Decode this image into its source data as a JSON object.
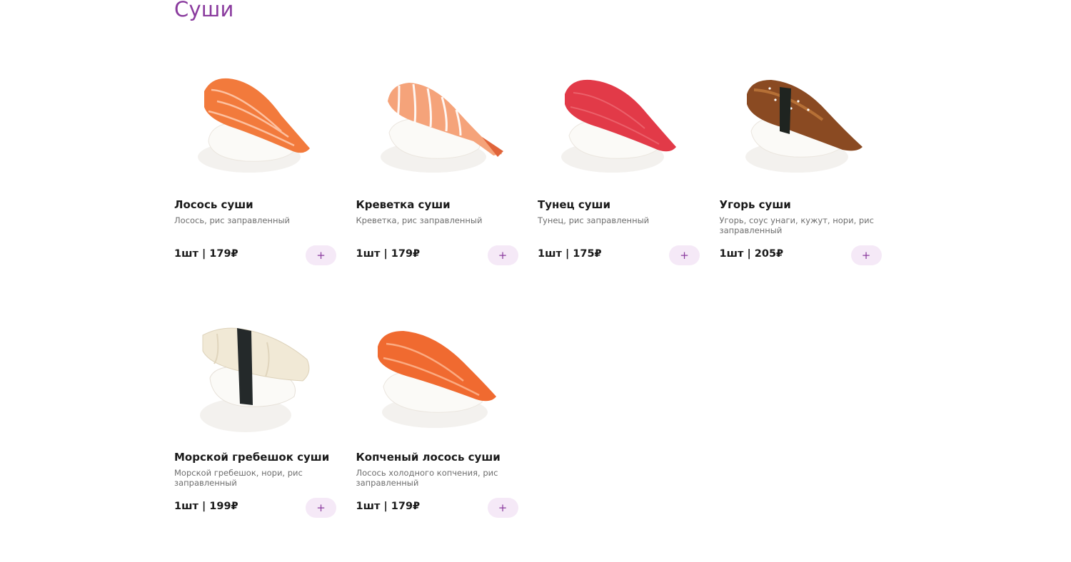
{
  "section": {
    "title": "Суши"
  },
  "products": [
    {
      "name": "Лосось суши",
      "description": "Лосось, рис заправленный",
      "price": "1шт | 179₽",
      "add_label": "+",
      "topping": "salmon",
      "topping_color": "#f27a3c"
    },
    {
      "name": "Креветка суши",
      "description": "Креветка, рис заправленный",
      "price": "1шт | 179₽",
      "add_label": "+",
      "topping": "shrimp",
      "topping_color": "#f5a37a"
    },
    {
      "name": "Тунец суши",
      "description": "Тунец, рис заправленный",
      "price": "1шт | 175₽",
      "add_label": "+",
      "topping": "tuna",
      "topping_color": "#e23a48"
    },
    {
      "name": "Угорь суши",
      "description": "Угорь, соус унаги, кужут, нори, рис заправленный",
      "price": "1шт | 205₽",
      "add_label": "+",
      "topping": "eel",
      "topping_color": "#8a4a22"
    },
    {
      "name": "Морской гребешок суши",
      "description": "Морской гребешок, нори, рис заправленный",
      "price": "1шт | 199₽",
      "add_label": "+",
      "topping": "scallop",
      "topping_color": "#f1e9d6"
    },
    {
      "name": "Копченый лосось суши",
      "description": "Лосось холодного копчения, рис заправленный",
      "price": "1шт | 179₽",
      "add_label": "+",
      "topping": "smoked-salmon",
      "topping_color": "#f06a30"
    }
  ]
}
